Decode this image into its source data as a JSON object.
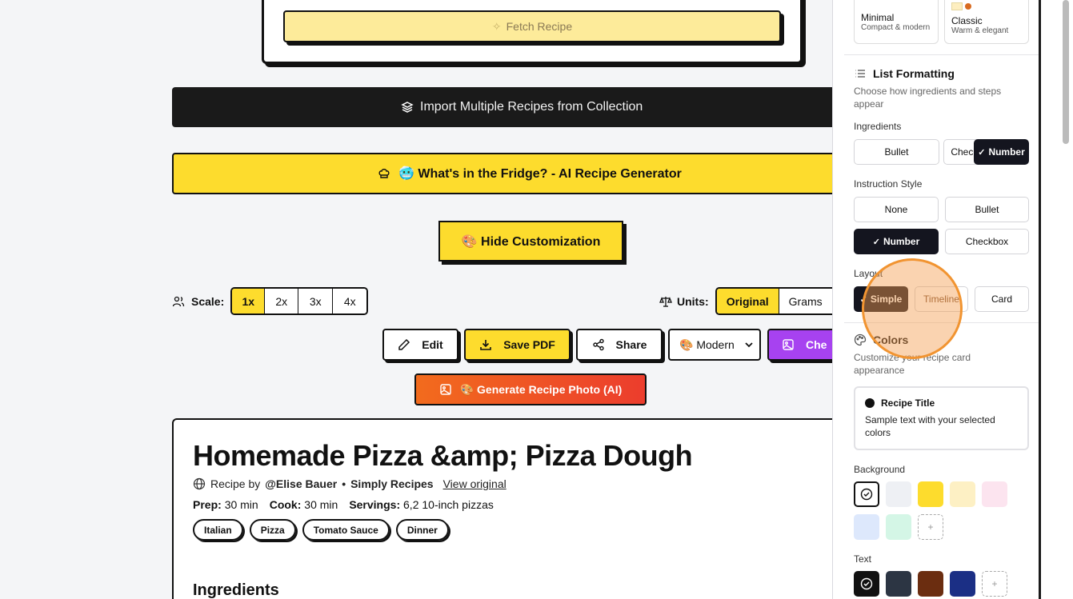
{
  "main": {
    "fetch_label": "Fetch Recipe",
    "import_label": "Import Multiple Recipes from Collection",
    "fridge_label": "🥶 What's in the Fridge? - AI Recipe Generator",
    "hide_label": "🎨 Hide Customization",
    "scale": {
      "label": "Scale:",
      "options": [
        "1x",
        "2x",
        "3x",
        "4x"
      ],
      "selected": "1x"
    },
    "units": {
      "label": "Units:",
      "options": [
        "Original",
        "Grams"
      ],
      "selected": "Original"
    },
    "actions": {
      "edit": "Edit",
      "save_pdf": "Save PDF",
      "share": "Share",
      "theme_select": "🎨 Modern",
      "checklist": "Che"
    },
    "generate_photo": "🎨 Generate Recipe Photo (AI)"
  },
  "recipe": {
    "title": "Homemade Pizza &amp; Pizza Dough",
    "recipe_by": "Recipe by",
    "author": "@Elise Bauer",
    "separator": "•",
    "source": "Simply Recipes",
    "view_original": "View original",
    "prep_label": "Prep:",
    "prep": "30 min",
    "cook_label": "Cook:",
    "cook": "30 min",
    "servings_label": "Servings:",
    "servings": "6,2 10-inch pizzas",
    "tags": [
      "Italian",
      "Pizza",
      "Tomato Sauce",
      "Dinner"
    ],
    "ingredients_heading": "Ingredients"
  },
  "panel": {
    "styles": [
      {
        "name": "Minimal",
        "desc": "Compact & modern"
      },
      {
        "name": "Classic",
        "desc": "Warm & elegant"
      }
    ],
    "list_formatting": {
      "title": "List Formatting",
      "desc": "Choose how ingredients and steps appear",
      "ingredients_label": "Ingredients",
      "ingredients_options": [
        "Bullet",
        "Checkbox",
        "Number"
      ],
      "ingredients_selected": "Number",
      "instruction_label": "Instruction Style",
      "instruction_options": [
        "None",
        "Bullet",
        "Number",
        "Checkbox"
      ],
      "instruction_selected": "Number",
      "layout_label": "Layout",
      "layout_options": [
        "Simple",
        "Timeline",
        "Card"
      ],
      "layout_selected": "Simple"
    },
    "colors": {
      "title": "Colors",
      "desc": "Customize your recipe card appearance",
      "preview_title": "Recipe Title",
      "preview_text": "Sample text with your selected colors",
      "background_label": "Background",
      "background_swatches": [
        "#ffffff",
        "#eef0f4",
        "#fddc2d",
        "#fdf0c4",
        "#fce4ef",
        "#dde8fc",
        "#d4f6e6"
      ],
      "text_label": "Text",
      "text_swatches": [
        "#111111",
        "#2c3543",
        "#6b2d10",
        "#1b2f85"
      ],
      "add_glyph": "+"
    }
  }
}
